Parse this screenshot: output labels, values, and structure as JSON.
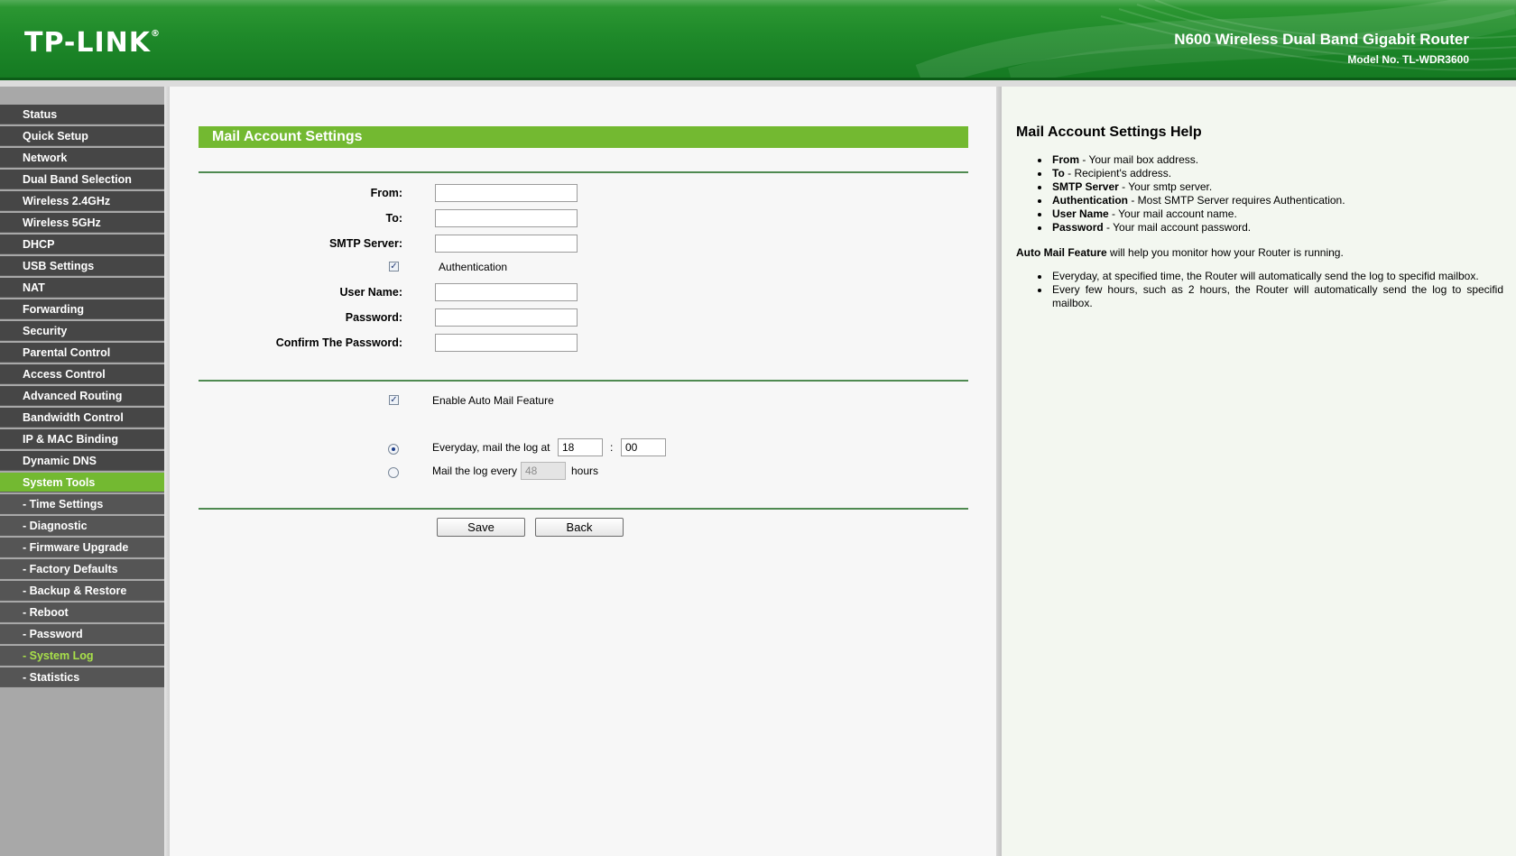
{
  "header": {
    "logo": "TP-LINK",
    "logo_reg": "®",
    "product": "N600 Wireless Dual Band Gigabit Router",
    "model": "Model No. TL-WDR3600"
  },
  "sidebar": {
    "items": [
      {
        "label": "Status"
      },
      {
        "label": "Quick Setup"
      },
      {
        "label": "Network"
      },
      {
        "label": "Dual Band Selection"
      },
      {
        "label": "Wireless 2.4GHz"
      },
      {
        "label": "Wireless 5GHz"
      },
      {
        "label": "DHCP"
      },
      {
        "label": "USB Settings"
      },
      {
        "label": "NAT"
      },
      {
        "label": "Forwarding"
      },
      {
        "label": "Security"
      },
      {
        "label": "Parental Control"
      },
      {
        "label": "Access Control"
      },
      {
        "label": "Advanced Routing"
      },
      {
        "label": "Bandwidth Control"
      },
      {
        "label": "IP & MAC Binding"
      },
      {
        "label": "Dynamic DNS"
      },
      {
        "label": "System Tools"
      },
      {
        "label": "- Time Settings"
      },
      {
        "label": "- Diagnostic"
      },
      {
        "label": "- Firmware Upgrade"
      },
      {
        "label": "- Factory Defaults"
      },
      {
        "label": "- Backup & Restore"
      },
      {
        "label": "- Reboot"
      },
      {
        "label": "- Password"
      },
      {
        "label": "- System Log"
      },
      {
        "label": "- Statistics"
      }
    ]
  },
  "main": {
    "title": "Mail Account Settings",
    "form": {
      "from_label": "From:",
      "from_value": "",
      "to_label": "To:",
      "to_value": "",
      "smtp_label": "SMTP Server:",
      "smtp_value": "",
      "auth_label": "Authentication",
      "auth_checked": true,
      "username_label": "User Name:",
      "username_value": "",
      "password_label": "Password:",
      "password_value": "",
      "confirm_label": "Confirm The Password:",
      "confirm_value": ""
    },
    "auto_mail": {
      "enable_label": "Enable Auto Mail Feature",
      "enable_checked": true,
      "everyday_label": "Everyday, mail the log at",
      "hour_value": "18",
      "colon": ":",
      "minute_value": "00",
      "every_label": "Mail the log every",
      "hours_value": "48",
      "hours_unit": "hours"
    },
    "buttons": {
      "save": "Save",
      "back": "Back"
    }
  },
  "help": {
    "title": "Mail Account Settings Help",
    "items": [
      {
        "term": "From",
        "desc": " - Your mail box address."
      },
      {
        "term": "To",
        "desc": " - Recipient's address."
      },
      {
        "term": "SMTP Server",
        "desc": " - Your smtp server."
      },
      {
        "term": "Authentication",
        "desc": " - Most SMTP Server requires Authentication."
      },
      {
        "term": "User Name",
        "desc": " - Your mail account name."
      },
      {
        "term": "Password",
        "desc": " - Your mail account password."
      }
    ],
    "auto_term": "Auto Mail Feature",
    "auto_desc": " will help you monitor how your Router is running.",
    "bullets": [
      "Everyday, at specified time, the Router will automatically send the log to specifid mailbox.",
      "Every few hours, such as 2 hours, the Router will automatically send the log to specifid mailbox."
    ]
  }
}
